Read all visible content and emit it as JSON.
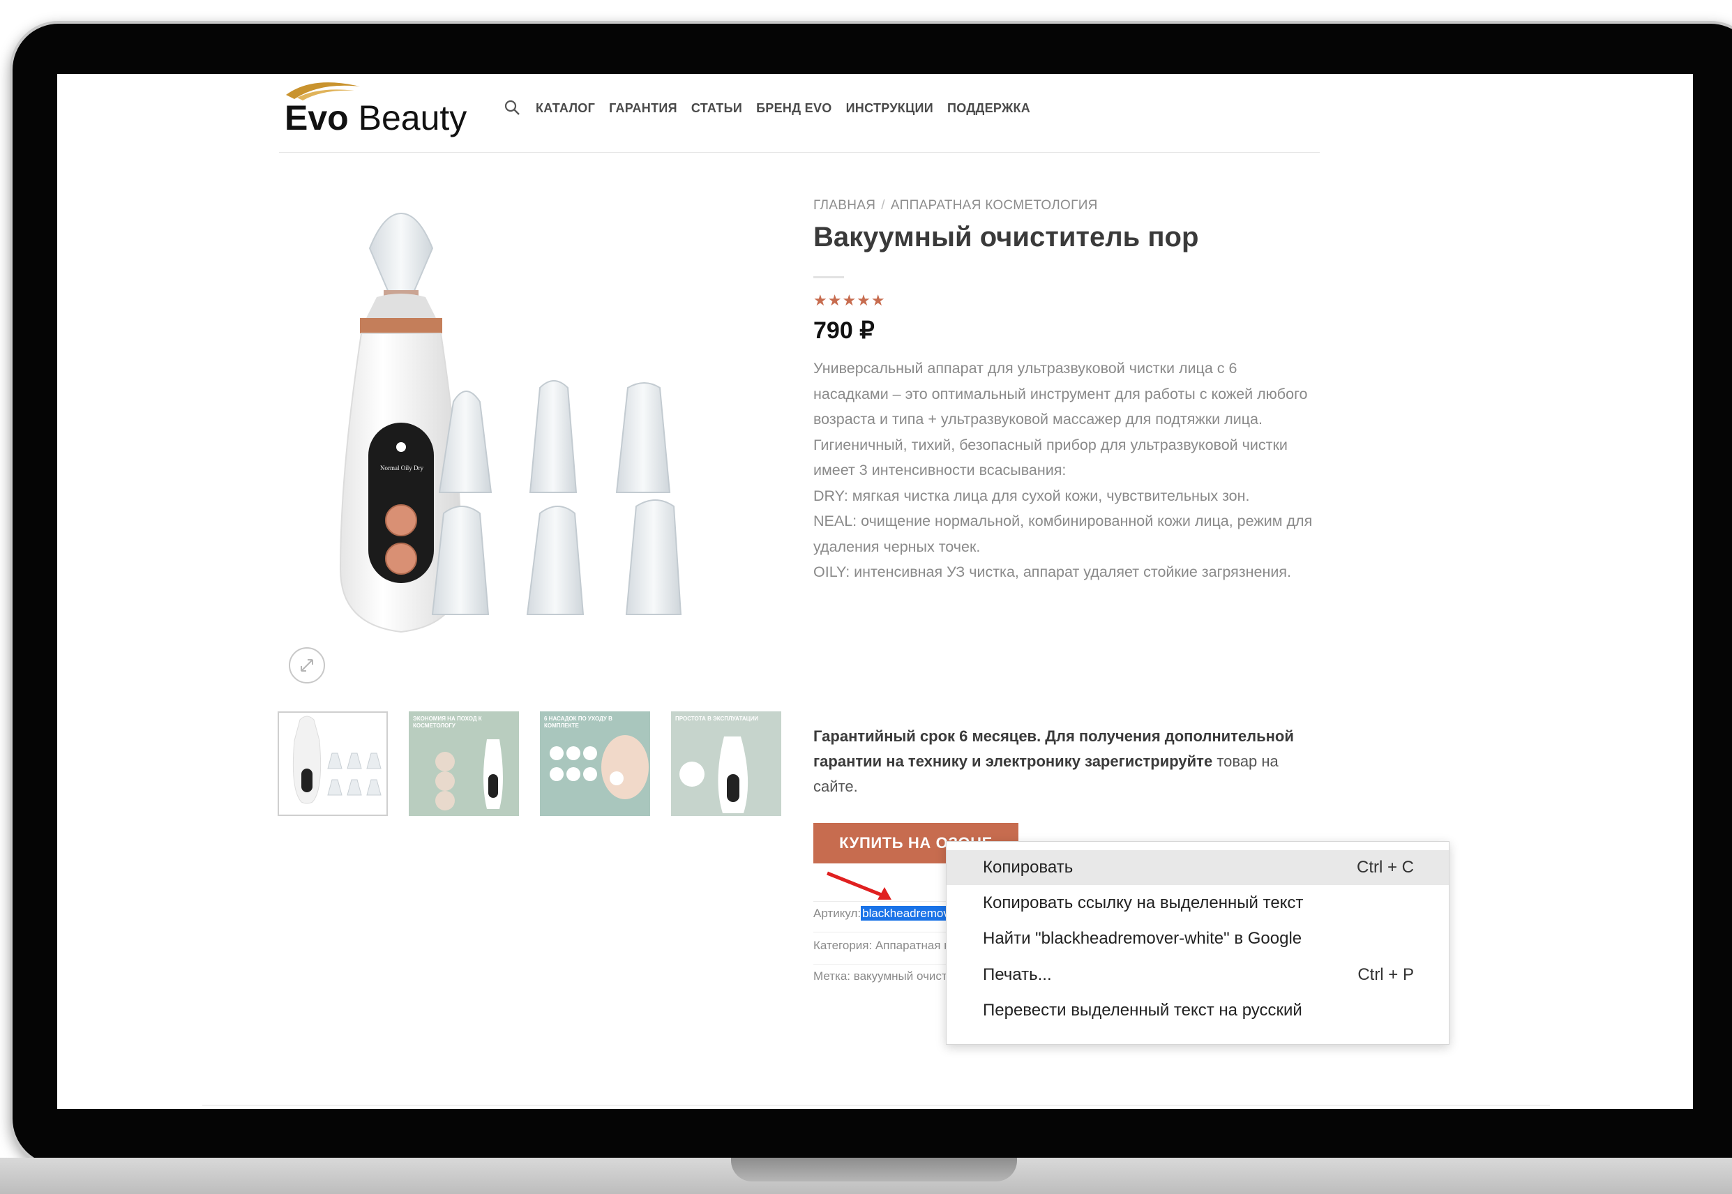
{
  "header": {
    "logo_bold": "Evo",
    "logo_light": "Beauty",
    "nav": [
      "КАТАЛОГ",
      "ГАРАНТИЯ",
      "СТАТЬИ",
      "БРЕНД EVO",
      "ИНСТРУКЦИИ",
      "ПОДДЕРЖКА"
    ]
  },
  "breadcrumb": [
    "ГЛАВНАЯ",
    "/",
    "АППАРАТНАЯ КОСМЕТОЛОГИЯ"
  ],
  "product": {
    "title": "Вакуумный очиститель пор",
    "rating_stars": "★★★★★",
    "rating": 5,
    "price": "790 ₽",
    "description": [
      "Универсальный аппарат для ультразвуковой чистки лица с 6 насадками – это оптимальный инструмент для работы с кожей любого возраста и типа + ультразвуковой массажер для подтяжки лица. Гигиеничный, тихий, безопасный прибор для ультразвуковой чистки имеет 3 интенсивности всасывания:",
      "DRY: мягкая чистка лица для сухой кожи, чувствительных зон.",
      "NEAL: очищение нормальной, комбинированной кожи лица, режим для удаления черных точек.",
      "OILY: интенсивная УЗ чистка, аппарат удаляет стойкие загрязнения."
    ],
    "warranty_bold": "Гарантийный срок 6 месяцев. Для получения дополнительной гарантии на технику и электронику зарегистрируйте",
    "warranty_normal": "товар на сайте.",
    "buy_button": "КУПИТЬ НА ОЗОНЕ",
    "sku_label": "Артикул:",
    "sku_value": "blackheadremover-white",
    "category": "Категория: Аппаратная косме",
    "tag": "Метка: вакуумный очистител",
    "device_mode_labels": "Normal  Oily  Dry"
  },
  "thumbnails": [
    {
      "label": ""
    },
    {
      "label": "ЭКОНОМИЯ НА ПОХОД К КОСМЕТОЛОГУ"
    },
    {
      "label": "6 НАСАДОК ПО УХОДУ В КОМПЛЕКТЕ"
    },
    {
      "label": "ПРОСТОТА В ЭКСПЛУАТАЦИИ"
    }
  ],
  "context_menu": {
    "items": [
      {
        "label": "Копировать",
        "shortcut": "Ctrl + C"
      },
      {
        "label": "Копировать ссылку на выделенный текст",
        "shortcut": ""
      },
      {
        "label": "Найти \"blackheadremover-white\" в Google",
        "shortcut": ""
      },
      {
        "label": "Печать...",
        "shortcut": "Ctrl + P"
      },
      {
        "label": "Перевести выделенный текст на русский",
        "shortcut": ""
      }
    ]
  },
  "colors": {
    "accent": "#c76c4f",
    "selection": "#1a73e8",
    "logo_gold": "#c9932e"
  },
  "icons": [
    "search-icon",
    "zoom-icon",
    "red-arrow-annotation"
  ]
}
